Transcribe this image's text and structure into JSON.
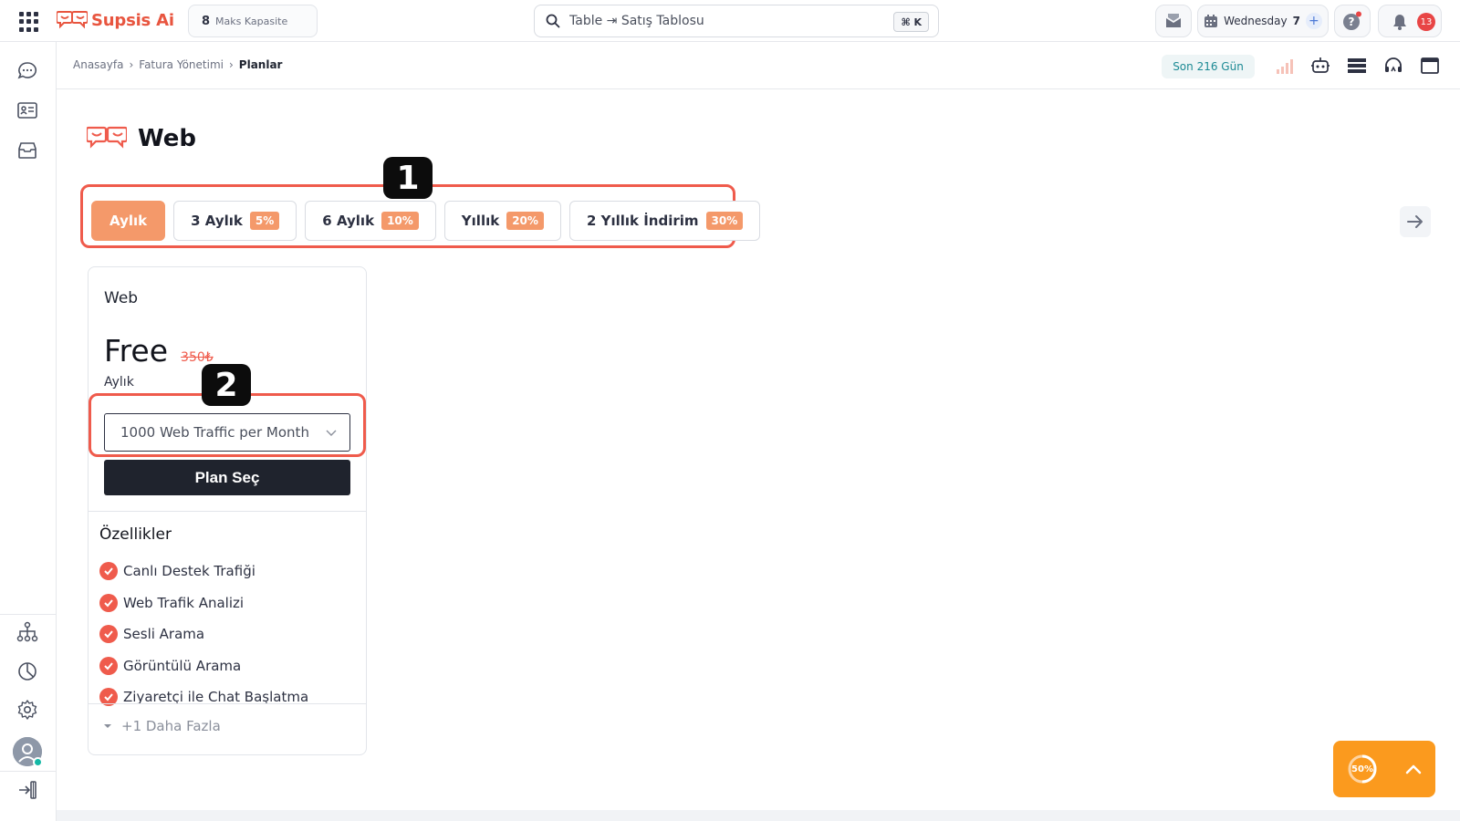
{
  "app": {
    "logo_text": "Supsis Ai"
  },
  "topbar": {
    "capacity_number": "8",
    "capacity_label": "Maks Kapasite",
    "search_value": "Table ⇥ Satış Tablosu",
    "search_shortcut": "⌘ K",
    "date_label": "Wednesday",
    "date_day": "7",
    "notification_count": "13"
  },
  "breadcrumb": {
    "items": [
      "Anasayfa",
      "Fatura Yönetimi",
      "Planlar"
    ],
    "separator": "›"
  },
  "header": {
    "range_label": "Son 216 Gün"
  },
  "page": {
    "title": "Web"
  },
  "period_tabs": [
    {
      "label": "Aylık",
      "discount": ""
    },
    {
      "label": "3 Aylık",
      "discount": "5%"
    },
    {
      "label": "6 Aylık",
      "discount": "10%"
    },
    {
      "label": "Yıllık",
      "discount": "20%"
    },
    {
      "label": "2 Yıllık İndirim",
      "discount": "30%"
    }
  ],
  "markers": [
    "1",
    "2"
  ],
  "plan": {
    "name": "Web",
    "price": "Free",
    "old_price": "350₺",
    "period": "Aylık",
    "select_value": "1000 Web Traffic per Month",
    "choose_label": "Plan Seç",
    "features_title": "Özellikler",
    "features": [
      "Canlı Destek Trafiği",
      "Web Trafik Analizi",
      "Sesli Arama",
      "Görüntülü Arama",
      "Ziyaretçi ile Chat Başlatma"
    ],
    "more_label": "+1 Daha Fazla"
  },
  "floating": {
    "progress_label": "50%",
    "progress_value": 0.5
  },
  "colors": {
    "accent": "#f4996a",
    "brand_red": "#ef5b4c",
    "dark": "#1f232d",
    "float": "#fb9a1e"
  }
}
